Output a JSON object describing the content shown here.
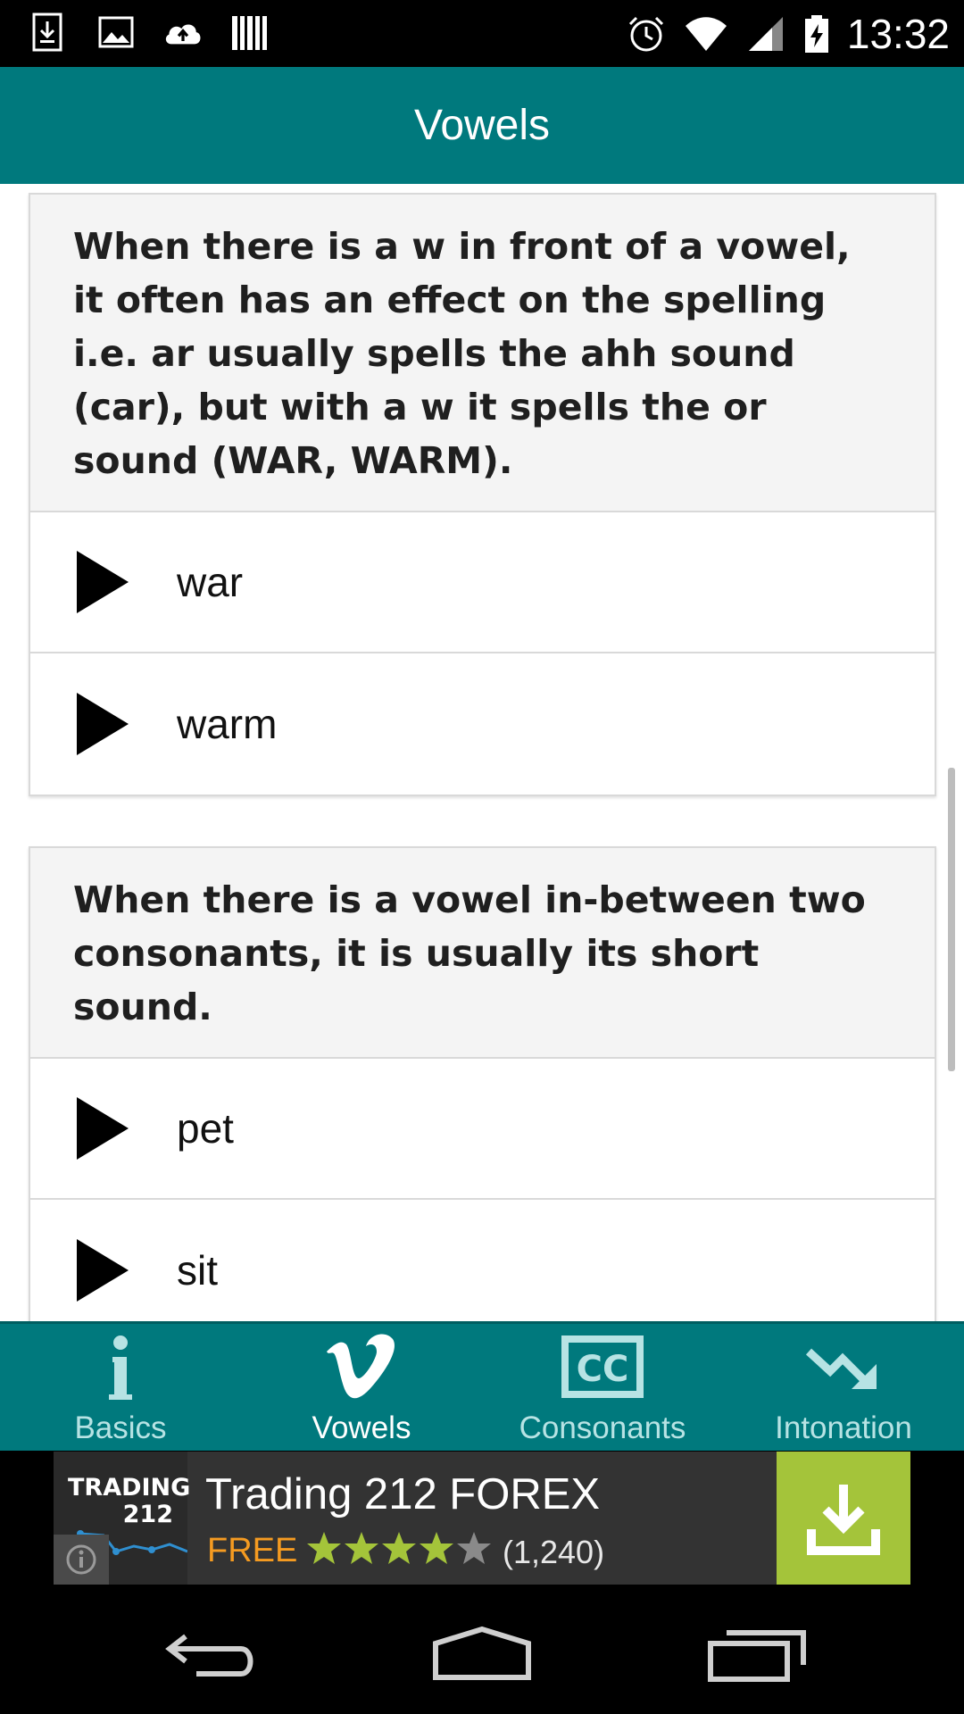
{
  "status_bar": {
    "time": "13:32",
    "left_icons": [
      "download-icon",
      "image-icon",
      "cloud-upload-icon",
      "barcode-icon"
    ],
    "right_icons": [
      "alarm-icon",
      "wifi-icon",
      "signal-icon",
      "battery-charging-icon"
    ]
  },
  "app_bar": {
    "title": "Vowels"
  },
  "cards": [
    {
      "rule": "When there is a w in front of a vowel, it often has an effect on the spelling i.e. ar usually spells the ahh sound (car), but with a w it spells the or sound (WAR, WARM).",
      "words": [
        "war",
        "warm"
      ]
    },
    {
      "rule": "When there is a vowel in-between two consonants, it is usually its short sound.",
      "words": [
        "pet",
        "sit"
      ]
    }
  ],
  "bottom_nav": {
    "items": [
      {
        "label": "Basics",
        "icon": "info-icon",
        "active": false
      },
      {
        "label": "Vowels",
        "icon": "vimeo-v-icon",
        "active": true
      },
      {
        "label": "Consonants",
        "icon": "closed-caption-icon",
        "active": false
      },
      {
        "label": "Intonation",
        "icon": "trend-down-icon",
        "active": false
      }
    ]
  },
  "ad": {
    "logo_line1": "TRADING",
    "logo_line2": "212",
    "title": "Trading 212 FOREX",
    "price": "FREE",
    "rating": 4,
    "rating_count": "(1,240)",
    "colors": {
      "price": "#f59b21",
      "download_bg": "#a4c43a",
      "star_filled": "#a4c43a"
    }
  },
  "colors": {
    "primary": "#00797d",
    "inactive_label": "#b7e3e4"
  }
}
